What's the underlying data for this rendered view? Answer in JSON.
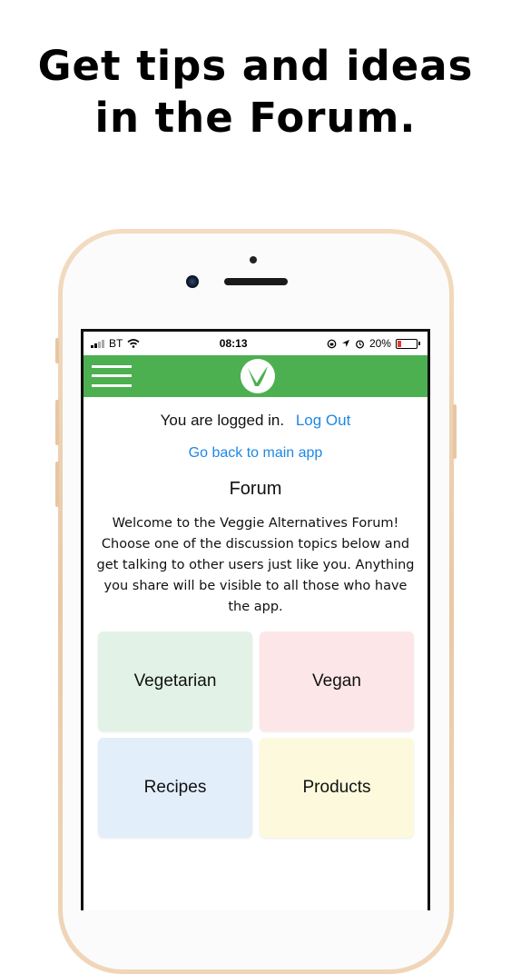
{
  "headline": {
    "line1": "Get tips and ideas",
    "line2": "in the Forum."
  },
  "statusbar": {
    "carrier": "BT",
    "time": "08:13",
    "battery_pct": "20%",
    "battery_level": 0.2
  },
  "app": {
    "login_text": "You are logged in.",
    "logout_label": "Log Out",
    "back_link": "Go back to main app",
    "title": "Forum",
    "welcome": "Welcome to the Veggie Alternatives Forum! Choose one of the discussion topics below and get talking to other users just like you. Anything you share will be visible to all those who have the app."
  },
  "topics": [
    {
      "label": "Vegetarian",
      "color": "#e3f2e6"
    },
    {
      "label": "Vegan",
      "color": "#fde6e8"
    },
    {
      "label": "Recipes",
      "color": "#e3eefb"
    },
    {
      "label": "Products",
      "color": "#fdf9dc"
    }
  ],
  "colors": {
    "nav": "#4caf50",
    "link": "#1e88e5"
  }
}
